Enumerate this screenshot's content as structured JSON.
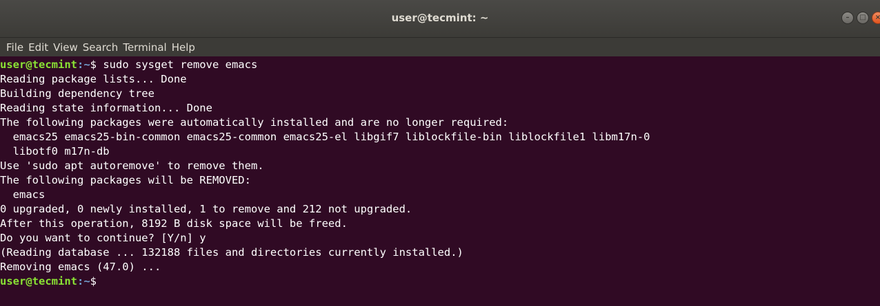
{
  "window": {
    "title": "user@tecmint: ~",
    "controls": {
      "minimize_glyph": "–",
      "maximize_glyph": "□",
      "close_glyph": "×"
    }
  },
  "menu": {
    "items": [
      "File",
      "Edit",
      "View",
      "Search",
      "Terminal",
      "Help"
    ]
  },
  "terminal": {
    "prompt": {
      "user": "user@tecmint",
      "path": ":~",
      "symbol": "$"
    },
    "command": " sudo sysget remove emacs",
    "output": [
      "Reading package lists... Done",
      "Building dependency tree",
      "Reading state information... Done",
      "The following packages were automatically installed and are no longer required:",
      "  emacs25 emacs25-bin-common emacs25-common emacs25-el libgif7 liblockfile-bin liblockfile1 libm17n-0",
      "  libotf0 m17n-db",
      "Use 'sudo apt autoremove' to remove them.",
      "The following packages will be REMOVED:",
      "  emacs",
      "0 upgraded, 0 newly installed, 1 to remove and 212 not upgraded.",
      "After this operation, 8192 B disk space will be freed.",
      "Do you want to continue? [Y/n] y",
      "(Reading database ... 132188 files and directories currently installed.)",
      "Removing emacs (47.0) ..."
    ]
  },
  "colors": {
    "background": "#300a24",
    "prompt_user": "#8ae234",
    "prompt_path": "#729fcf",
    "text": "#ffffff"
  }
}
